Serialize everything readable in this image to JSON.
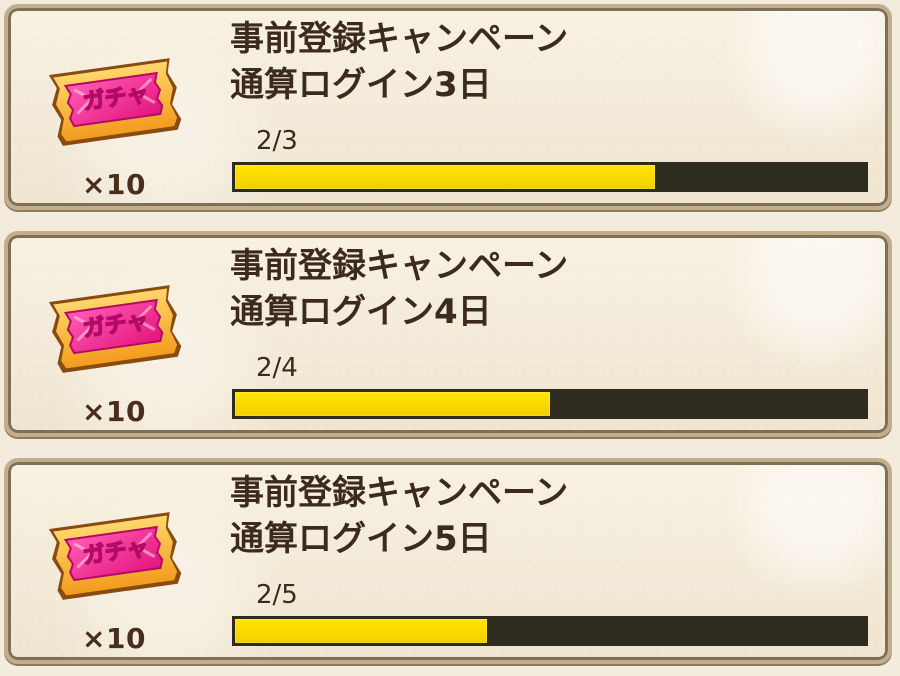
{
  "missions": [
    {
      "title_line1": "事前登録キャンペーン",
      "title_line2": "通算ログイン3日",
      "progress_text": "2/3",
      "progress_fraction": 0.6667,
      "reward_label": "ガチャ",
      "reward_quantity": "×10",
      "reward_icon": "gacha-ticket-icon"
    },
    {
      "title_line1": "事前登録キャンペーン",
      "title_line2": "通算ログイン4日",
      "progress_text": "2/4",
      "progress_fraction": 0.5,
      "reward_label": "ガチャ",
      "reward_quantity": "×10",
      "reward_icon": "gacha-ticket-icon"
    },
    {
      "title_line1": "事前登録キャンペーン",
      "title_line2": "通算ログイン5日",
      "progress_text": "2/5",
      "progress_fraction": 0.4,
      "reward_label": "ガチャ",
      "reward_quantity": "×10",
      "reward_icon": "gacha-ticket-icon"
    }
  ],
  "colors": {
    "panel_background": "#f3ecdc",
    "panel_border": "#7e6f59",
    "progress_fill": "#ffe600",
    "progress_track": "#2d2c1f",
    "ticket_pink": "#f12e93",
    "ticket_orange": "#f7a11d"
  }
}
